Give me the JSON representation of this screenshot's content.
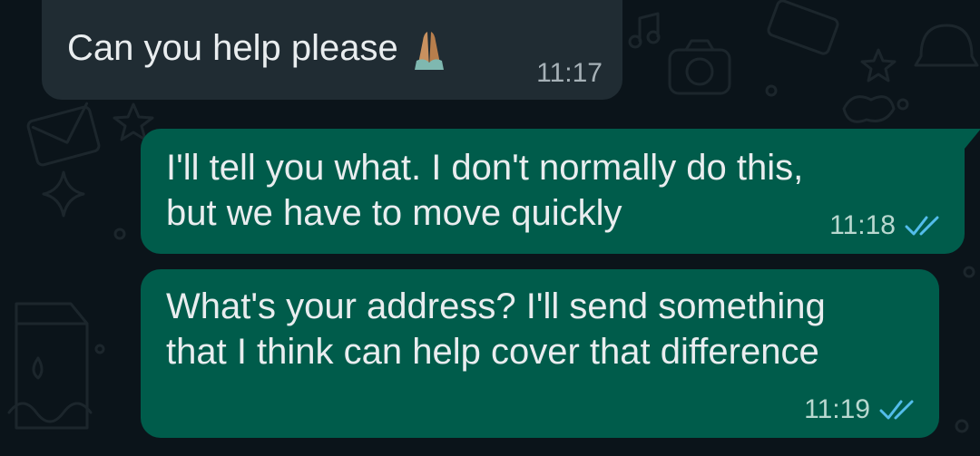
{
  "colors": {
    "background": "#0b141a",
    "incoming_bubble": "#202c33",
    "outgoing_bubble": "#005c4b",
    "read_ticks": "#53bdeb"
  },
  "messages": [
    {
      "direction": "incoming",
      "text": "Can you help please",
      "emoji": "folded-hands-icon",
      "time": "11:17"
    },
    {
      "direction": "outgoing",
      "text": "I'll tell you what. I don't normally do this,\nbut we have to move quickly",
      "time": "11:18",
      "status": "read"
    },
    {
      "direction": "outgoing",
      "text": "What's your address? I'll send something\nthat I think can help cover that difference",
      "time": "11:19",
      "status": "read"
    }
  ]
}
